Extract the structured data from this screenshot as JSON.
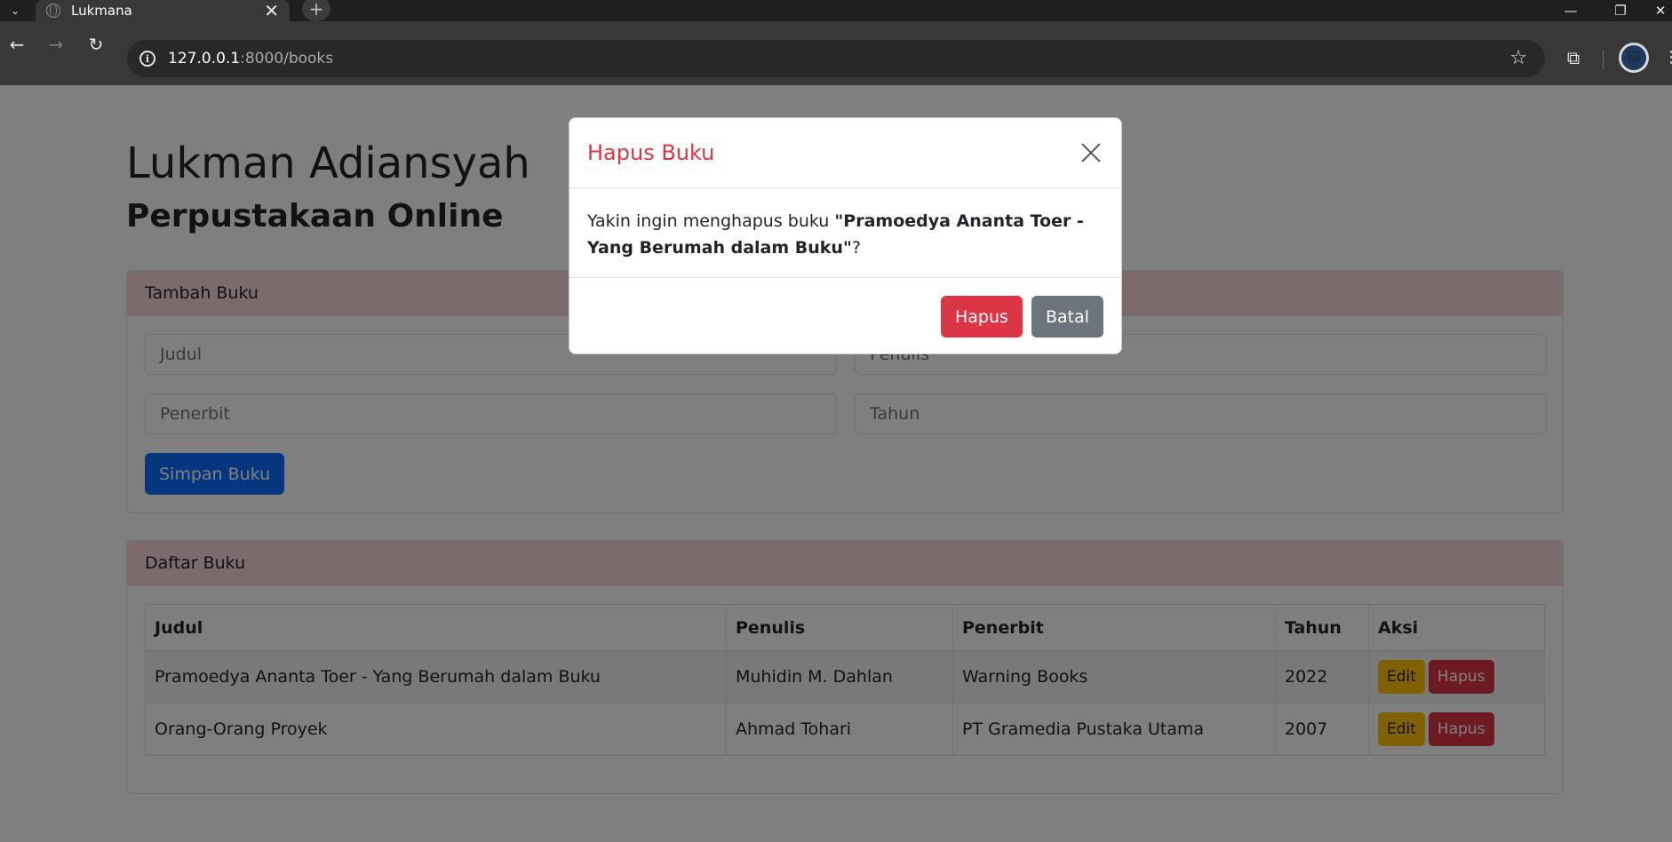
{
  "browser": {
    "tab_title": "Lukmana",
    "url_host": "127.0.0.1",
    "url_path": ":8000/books"
  },
  "page": {
    "title": "Lukman Adiansyah",
    "subtitle": "Perpustakaan Online"
  },
  "add_form": {
    "header": "Tambah Buku",
    "judul_placeholder": "Judul",
    "penulis_placeholder": "Penulis",
    "penerbit_placeholder": "Penerbit",
    "tahun_placeholder": "Tahun",
    "save_label": "Simpan Buku"
  },
  "book_list": {
    "header": "Daftar Buku",
    "columns": [
      "Judul",
      "Penulis",
      "Penerbit",
      "Tahun",
      "Aksi"
    ],
    "rows": [
      {
        "judul": "Pramoedya Ananta Toer - Yang Berumah dalam Buku",
        "penulis": "Muhidin M. Dahlan",
        "penerbit": "Warning Books",
        "tahun": "2022"
      },
      {
        "judul": "Orang-Orang Proyek",
        "penulis": "Ahmad Tohari",
        "penerbit": "PT Gramedia Pustaka Utama",
        "tahun": "2007"
      }
    ],
    "edit_label": "Edit",
    "delete_label": "Hapus"
  },
  "modal": {
    "title": "Hapus Buku",
    "message_prefix": "Yakin ingin menghapus buku ",
    "book_quoted": "\"Pramoedya Ananta Toer - Yang Berumah dalam Buku\"",
    "message_suffix": "?",
    "confirm_label": "Hapus",
    "cancel_label": "Batal"
  },
  "colors": {
    "primary": "#0d6efd",
    "danger": "#dc3545",
    "warning": "#ffc107",
    "secondary": "#6c757d",
    "card_header": "#f8d7da"
  }
}
